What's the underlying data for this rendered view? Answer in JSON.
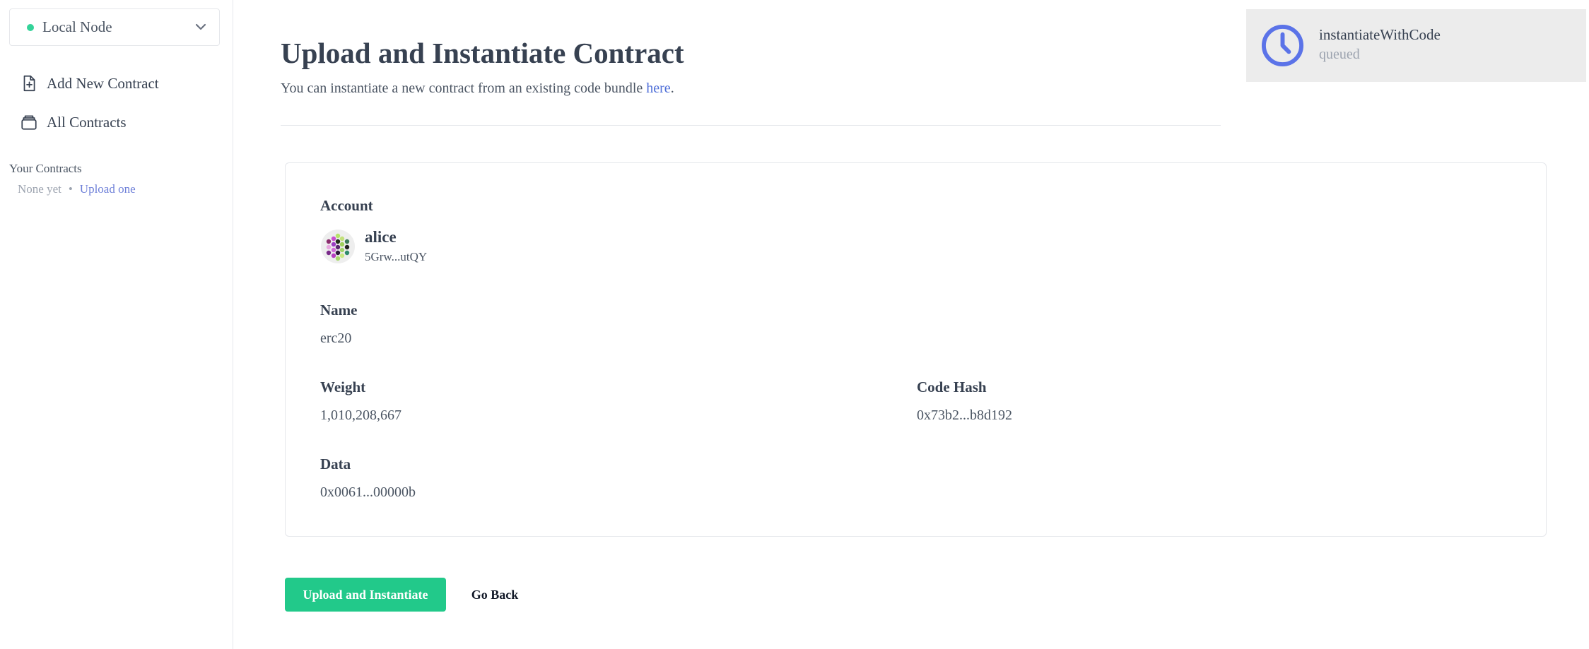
{
  "sidebar": {
    "node_selector": {
      "label": "Local Node",
      "status_color": "#34d399"
    },
    "nav": [
      {
        "label": "Add New Contract",
        "icon": "file-plus-icon"
      },
      {
        "label": "All Contracts",
        "icon": "archive-icon"
      }
    ],
    "your_contracts": {
      "heading": "Your Contracts",
      "empty_text": "None yet",
      "separator": "•",
      "upload_link": "Upload one"
    }
  },
  "main": {
    "title": "Upload and Instantiate Contract",
    "subtitle_prefix": "You can instantiate a new contract from an existing code bundle ",
    "subtitle_link": "here",
    "subtitle_suffix": "."
  },
  "review": {
    "account": {
      "label": "Account",
      "name": "alice",
      "address": "5Grw...utQY",
      "avatar_icon": "identicon-icon"
    },
    "name": {
      "label": "Name",
      "value": "erc20"
    },
    "weight": {
      "label": "Weight",
      "value": "1,010,208,667"
    },
    "code_hash": {
      "label": "Code Hash",
      "value": "0x73b2...b8d192"
    },
    "data": {
      "label": "Data",
      "value": "0x0061...00000b"
    }
  },
  "actions": {
    "submit_label": "Upload and Instantiate",
    "back_label": "Go Back",
    "accent_color": "#22c98a"
  },
  "notification": {
    "title": "instantiateWithCode",
    "status": "queued",
    "icon": "clock-icon",
    "icon_color": "#5b73e8"
  }
}
